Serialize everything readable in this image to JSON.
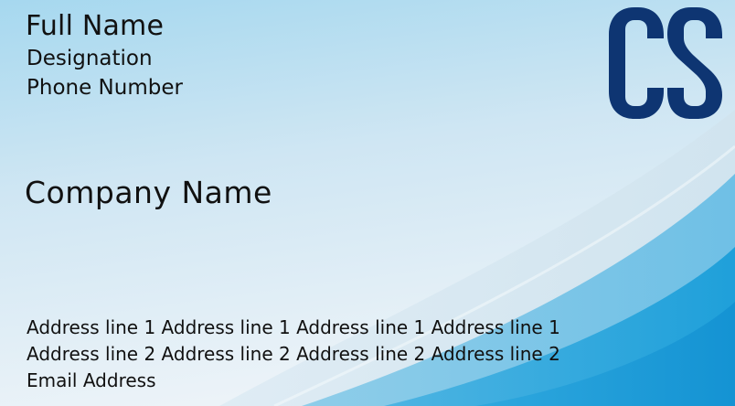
{
  "card": {
    "full_name": "Full Name",
    "designation": "Designation",
    "phone": "Phone Number",
    "company": "Company Name",
    "address_line_1": "Address line 1 Address line 1 Address line 1 Address line 1",
    "address_line_2": "Address line 2 Address line 2 Address line 2 Address line 2",
    "email": "Email Address"
  },
  "colors": {
    "logo": "#0E3572",
    "background_light": "#EAF2F8",
    "background_sky": "#A8D8EE",
    "wave_blue": "#2AA3DA"
  }
}
